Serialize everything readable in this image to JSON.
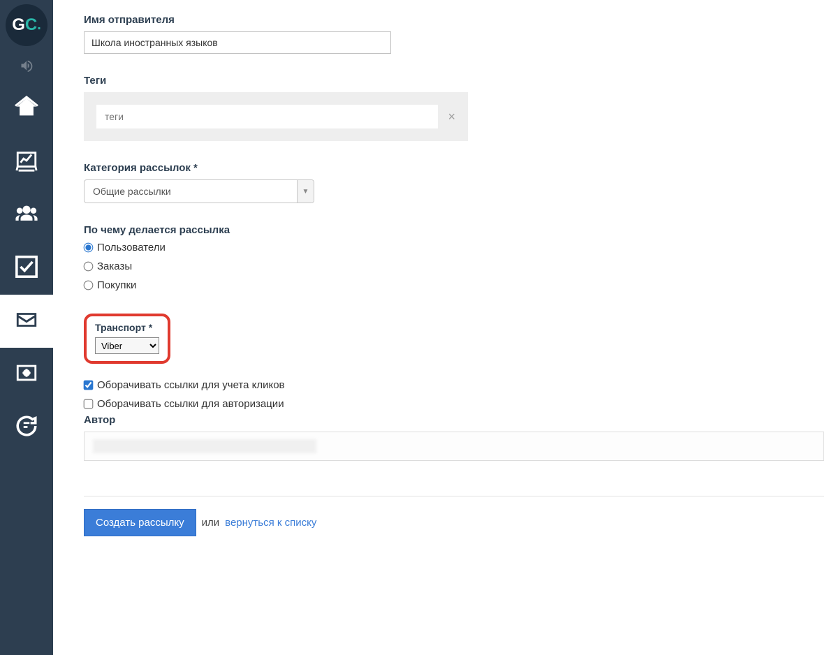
{
  "logo": {
    "g": "G",
    "c": "C",
    "dot": "."
  },
  "senderName": {
    "label": "Имя отправителя",
    "value": "Школа иностранных языков"
  },
  "tags": {
    "label": "Теги",
    "placeholder": "теги",
    "closeGlyph": "×"
  },
  "category": {
    "label": "Категория рассылок *",
    "selected": "Общие рассылки",
    "caret": "▼"
  },
  "basis": {
    "label": "По чему делается рассылка",
    "options": [
      "Пользователи",
      "Заказы",
      "Покупки"
    ],
    "selectedIndex": 0
  },
  "transport": {
    "label": "Транспорт *",
    "selected": "Viber"
  },
  "wrapClicks": {
    "label": "Оборачивать ссылки для учета кликов",
    "checked": true
  },
  "wrapAuth": {
    "label": "Оборачивать ссылки для авторизации",
    "checked": false
  },
  "author": {
    "label": "Автор"
  },
  "actions": {
    "submit": "Создать рассылку",
    "orText": "или",
    "backLink": "вернуться к списку"
  },
  "navIcons": [
    "volume-icon",
    "home-icon",
    "chart-icon",
    "users-icon",
    "check-icon",
    "mail-icon",
    "settings-box-icon",
    "chat-icon"
  ]
}
